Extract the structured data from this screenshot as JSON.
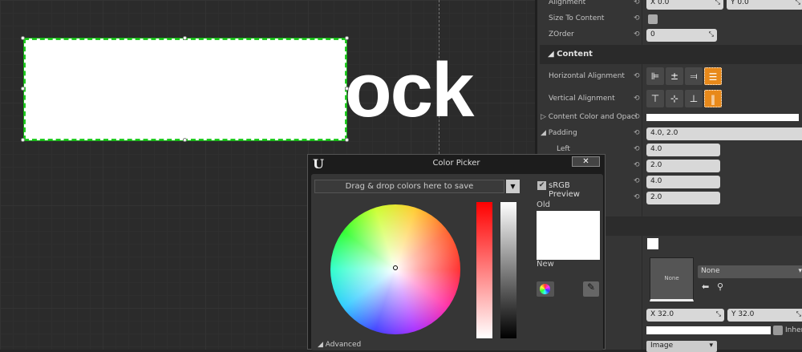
{
  "canvas": {
    "text_visible": "ock",
    "text_full": "Text Block"
  },
  "details": {
    "alignment": {
      "label": "Alignment",
      "x": "X  0.0",
      "y": "Y  0.0"
    },
    "size_to_content": {
      "label": "Size To Content"
    },
    "zorder": {
      "label": "ZOrder",
      "value": "0"
    },
    "content_section": "Content",
    "horizontal_alignment": {
      "label": "Horizontal Alignment",
      "selected": "fill"
    },
    "vertical_alignment": {
      "label": "Vertical Alignment",
      "selected": "fill"
    },
    "content_color": {
      "label": "Content Color and Opaci"
    },
    "padding": {
      "label": "Padding",
      "value": "4.0, 2.0",
      "left_label": "Left",
      "left": "4.0",
      "top": "2.0",
      "right": "4.0",
      "bottom": "2.0"
    },
    "brush": {
      "thumb_label": "None",
      "asset": "None",
      "x": "X  32.0",
      "y": "Y  32.0",
      "inherit": "Inheri",
      "draw_as": "Image"
    }
  },
  "color_picker": {
    "title": "Color Picker",
    "swatch_bar": "Drag & drop colors here to save",
    "srgb": "sRGB Preview",
    "srgb_checked": true,
    "old": "Old",
    "new": "New",
    "advanced": "Advanced",
    "old_color": "#ffffff",
    "new_color": "#ffffff"
  }
}
